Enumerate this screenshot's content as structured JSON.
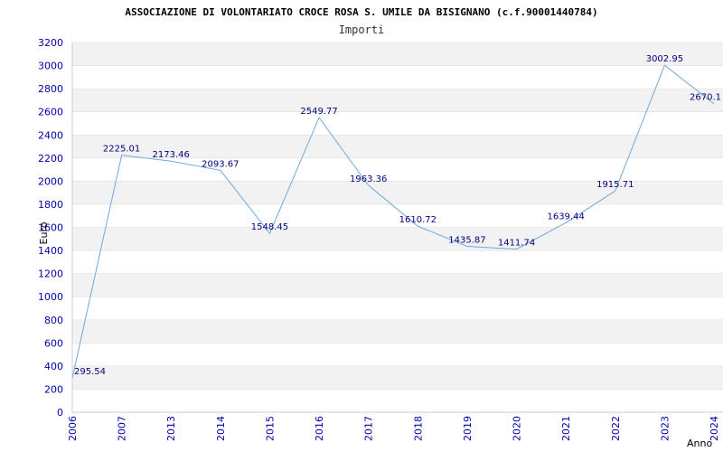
{
  "chart_data": {
    "type": "line",
    "title": "ASSOCIAZIONE DI VOLONTARIATO CROCE ROSA S. UMILE DA BISIGNANO (c.f.90001440784)",
    "subtitle": "Importi",
    "xlabel": "Anno",
    "ylabel": "Euro",
    "ylim": [
      0,
      3200
    ],
    "yticks": [
      0,
      200,
      400,
      600,
      800,
      1000,
      1200,
      1400,
      1600,
      1800,
      2000,
      2200,
      2400,
      2600,
      2800,
      3000,
      3200
    ],
    "categories": [
      "2006",
      "2007",
      "2013",
      "2014",
      "2015",
      "2016",
      "2017",
      "2018",
      "2019",
      "2020",
      "2021",
      "2022",
      "2023",
      "2024"
    ],
    "series": [
      {
        "values": [
          295.54,
          2225.01,
          2173.46,
          2093.67,
          1548.45,
          2549.77,
          1963.36,
          1610.72,
          1435.87,
          1411.74,
          1639.44,
          1915.71,
          3002.95,
          2670.1
        ],
        "labels": [
          "295.54",
          "2225.01",
          "2173.46",
          "2093.67",
          "1548.45",
          "2549.77",
          "1963.36",
          "1610.72",
          "1435.87",
          "1411.74",
          "1639.44",
          "1915.71",
          "3002.95",
          "2670.1"
        ]
      }
    ],
    "grid": "horizontal bands",
    "colors": {
      "line": "#6fa8dc",
      "band": "#f2f2f2",
      "gridline": "#dddddd",
      "tick_text": "#0000aa",
      "label_text": "#000080"
    }
  }
}
